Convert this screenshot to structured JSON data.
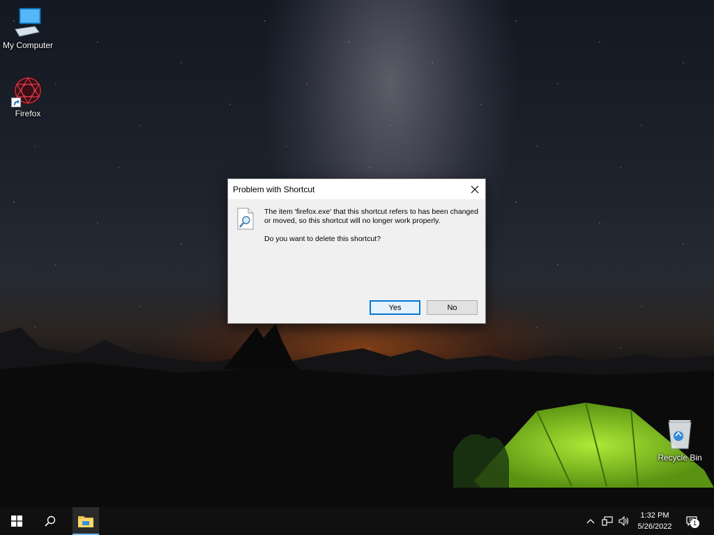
{
  "desktop": {
    "icons": [
      {
        "label": "My Computer",
        "icon": "computer-icon"
      },
      {
        "label": "Firefox",
        "icon": "firefox-icon"
      },
      {
        "label": "Recycle Bin",
        "icon": "recycle-bin-icon"
      }
    ]
  },
  "dialog": {
    "title": "Problem with Shortcut",
    "close_icon": "close-icon",
    "message_icon": "file-search-icon",
    "message_line": "The item 'firefox.exe' that this shortcut refers to has been changed or moved, so this shortcut will no longer work properly.",
    "question": "Do you want to delete this shortcut?",
    "yes_label": "Yes",
    "no_label": "No",
    "default_button_color": "#0078d7"
  },
  "taskbar": {
    "start_icon": "windows-start-icon",
    "search_icon": "search-icon",
    "pinned": [
      {
        "name": "File Explorer",
        "icon": "folder-icon",
        "active": true
      }
    ],
    "tray": {
      "chevron_icon": "chevron-up-icon",
      "network_icon": "network-icon",
      "volume_icon": "volume-icon",
      "time": "1:32 PM",
      "date": "5/26/2022",
      "notifications_icon": "action-center-icon",
      "notification_count": "1"
    }
  },
  "colors": {
    "taskbar_bg": "#101010",
    "dialog_bg": "#f0f0f0",
    "accent": "#0078d7"
  }
}
